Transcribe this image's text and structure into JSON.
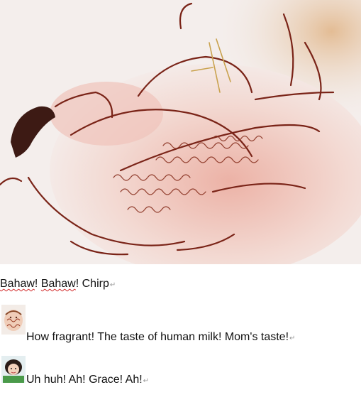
{
  "illustration": {
    "name": "sketch of a sleeping baby nursing",
    "palette": {
      "background": "#f4eeec",
      "skin": "#f1d7d1",
      "blush": "#e9a59a",
      "ink": "#7a2418",
      "hair": "#3d1a14",
      "wash": "#e8c09a"
    }
  },
  "lines": [
    {
      "words": [
        "Bahaw",
        "! ",
        "Bahaw",
        "! Chirp"
      ],
      "mark": "↵"
    },
    {
      "text": "How fragrant! The taste of human milk! Mom's taste!",
      "mark": "↵"
    },
    {
      "text": "Uh huh! Ah! Grace! Ah!",
      "mark": "↵"
    }
  ],
  "avatars": [
    {
      "icon": "baby-sketch-avatar-icon"
    },
    {
      "icon": "girl-photo-avatar-icon"
    }
  ]
}
